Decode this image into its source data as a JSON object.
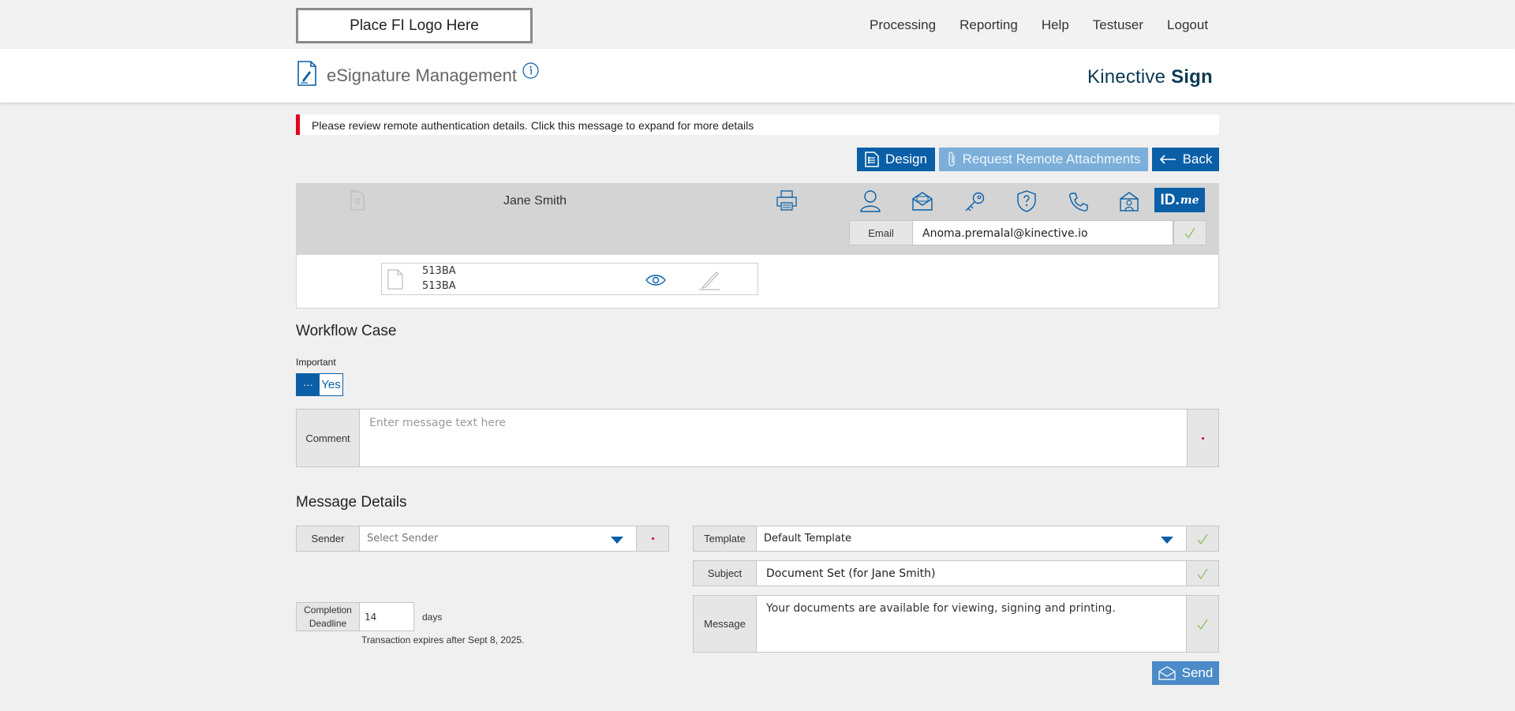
{
  "topbar": {
    "logo_text": "Place FI Logo Here",
    "nav": [
      "Processing",
      "Reporting",
      "Help",
      "Testuser",
      "Logout"
    ]
  },
  "header": {
    "title": "eSignature Management",
    "brand_light": "Kinective",
    "brand_bold": "Sign"
  },
  "alert": {
    "text": "Please review remote authentication details. Click this message to expand for more details",
    "color": "#e3001b"
  },
  "actions": {
    "design": "Design",
    "remote_attachments": "Request Remote Attachments",
    "back": "Back",
    "send": "Send"
  },
  "signer": {
    "name": "Jane Smith",
    "auth_icons": [
      "person-icon",
      "email-auth-icon",
      "key-icon",
      "security-question-icon",
      "phone-icon",
      "id-card-icon"
    ],
    "idme_text": "ID.",
    "idme_suffix": "me",
    "email_label": "Email",
    "email_value": "Anoma.premalal@kinective.io"
  },
  "documents": [
    {
      "line1": "513BA",
      "line2": "513BA"
    }
  ],
  "workflow": {
    "title": "Workflow Case",
    "important_label": "Important",
    "important_knob": "···",
    "important_value": "Yes",
    "comment_label": "Comment",
    "comment_placeholder": "Enter message text here"
  },
  "message_details": {
    "title": "Message Details",
    "sender_label": "Sender",
    "sender_value": "Select Sender",
    "template_label": "Template",
    "template_value": "Default Template",
    "subject_label": "Subject",
    "subject_value": "Document Set (for Jane Smith)",
    "message_label": "Message",
    "message_value": "Your documents are available for viewing, signing and printing.",
    "deadline_label_1": "Completion",
    "deadline_label_2": "Deadline",
    "deadline_value": "14",
    "deadline_unit": "days",
    "expires_text": "Transaction expires after Sept 8, 2025."
  },
  "colors": {
    "primary": "#0a5fa7",
    "primary_light": "#7bafd9",
    "check": "#8bbf5b",
    "required": "#d0021b"
  }
}
